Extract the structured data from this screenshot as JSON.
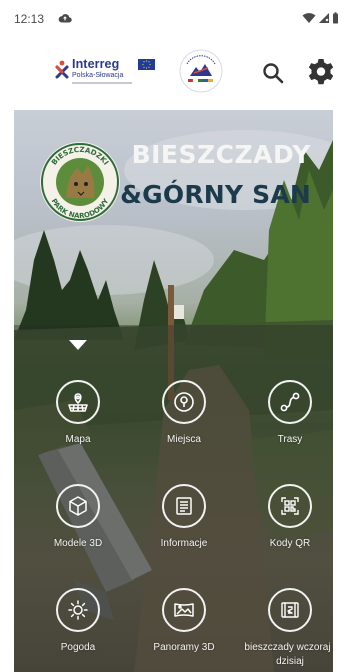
{
  "status_bar": {
    "time": "12:13",
    "cloud_icon": "cloud-upload-icon",
    "wifi_icon": "wifi-icon",
    "signal_icon": "signal-icon",
    "battery_icon": "battery-icon"
  },
  "header": {
    "interreg_title": "Interreg",
    "interreg_subtitle": "Polska-Słowacja",
    "search_icon": "search-icon",
    "settings_icon": "gear-icon",
    "brand_color": "#2b3a8f"
  },
  "hero": {
    "title_line1": "BIESZCZADY",
    "title_line2": "&GÓRNY SAN",
    "park_logo_top": "BIESZCZADZKI",
    "park_logo_bottom": "PARK NARODOWY",
    "title_color_1": "#f5f5f5",
    "title_color_2": "#1b3b4a"
  },
  "menu": {
    "items": [
      {
        "label": "Mapa",
        "icon": "map-icon"
      },
      {
        "label": "Miejsca",
        "icon": "location-pin-icon"
      },
      {
        "label": "Trasy",
        "icon": "route-icon"
      },
      {
        "label": "Modele 3D",
        "icon": "cube-3d-icon"
      },
      {
        "label": "Informacje",
        "icon": "document-icon"
      },
      {
        "label": "Kody QR",
        "icon": "qr-code-icon"
      },
      {
        "label": "Pogoda",
        "icon": "sun-icon"
      },
      {
        "label": "Panoramy 3D",
        "icon": "panorama-icon"
      },
      {
        "label": "bieszczady wczoraj i dzisiaj",
        "icon": "history-map-icon"
      }
    ]
  }
}
